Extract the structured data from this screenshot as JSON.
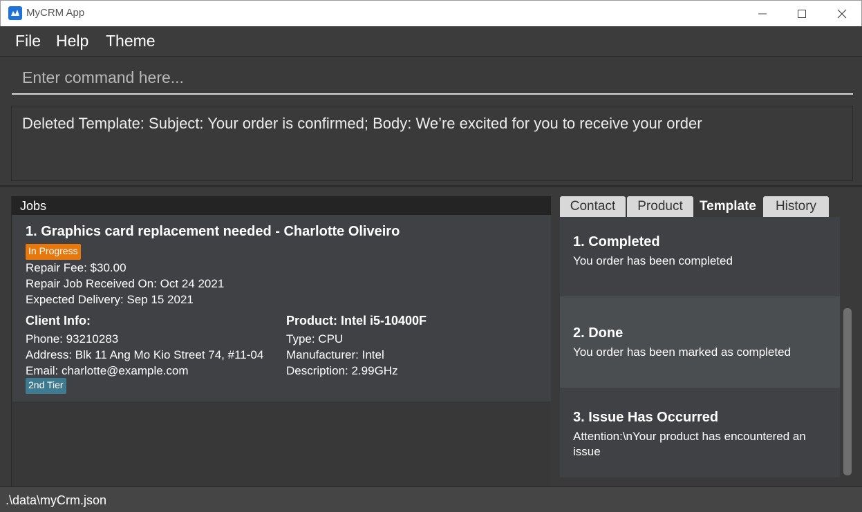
{
  "window": {
    "title": "MyCRM App",
    "app_icon": "mycrm-logo-icon"
  },
  "menu": {
    "items": [
      "File",
      "Help",
      "Theme"
    ]
  },
  "command": {
    "placeholder": "Enter command here...",
    "value": ""
  },
  "result": {
    "text": "Deleted Template: Subject: Your order is confirmed; Body: We’re excited for you to receive your order"
  },
  "jobs": {
    "header": "Jobs",
    "items": [
      {
        "title": "1. Graphics card replacement needed - Charlotte Oliveiro",
        "status": "In Progress",
        "status_color": "#e6780e",
        "fee": "Repair Fee: $30.00",
        "received": "Repair Job Received On: Oct 24 2021",
        "delivery": "Expected Delivery: Sep 15 2021",
        "client": {
          "heading": "Client Info:",
          "phone": "Phone: 93210283",
          "address": "Address: Blk 11 Ang Mo Kio Street 74, #11-04",
          "email": "Email: charlotte@example.com",
          "tier": "2nd Tier",
          "tier_color": "#3e7b91"
        },
        "product": {
          "heading": "Product: Intel i5-10400F",
          "type": "Type: CPU",
          "manufacturer": "Manufacturer: Intel",
          "description": "Description: 2.99GHz"
        }
      }
    ]
  },
  "tabs": {
    "items": [
      "Contact",
      "Product",
      "Template",
      "History"
    ],
    "active": "Template"
  },
  "templates": {
    "items": [
      {
        "title": "1.  Completed",
        "body": "You order has been completed"
      },
      {
        "title": "2.  Done",
        "body": "You order has been marked as completed"
      },
      {
        "title": "3.  Issue Has Occurred",
        "body": "Attention:\\nYour product has encountered an issue"
      }
    ]
  },
  "status": {
    "path": ".\\data\\myCrm.json"
  }
}
